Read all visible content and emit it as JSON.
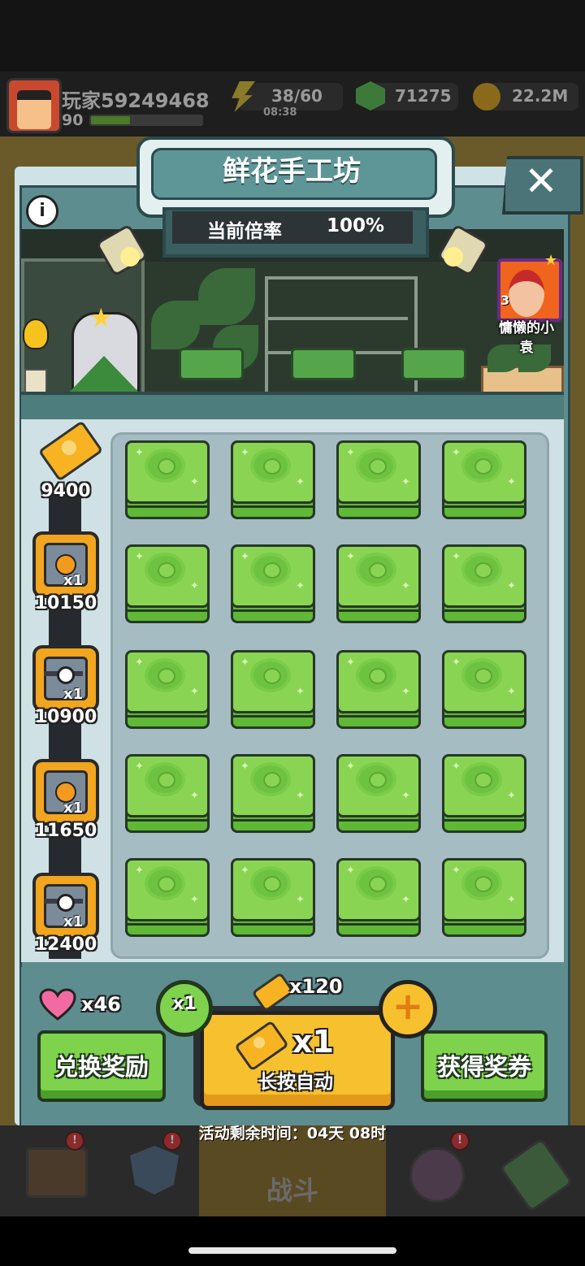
{
  "player": {
    "name": "玩家59249468",
    "level": "90",
    "level_progress": 0.35
  },
  "resources": {
    "energy": {
      "value": "38/60",
      "timer": "08:38",
      "icon": "lightning-icon"
    },
    "gems": {
      "value": "71275",
      "icon": "gem-icon"
    },
    "coins": {
      "value": "22.2M",
      "icon": "coin-icon"
    }
  },
  "modal": {
    "title": "鲜花手工坊",
    "rate_label": "当前倍率",
    "rate_value": "100%",
    "close_label": "✕",
    "info_label": "i",
    "character_name": "慵懒的小袁",
    "character_level": "3"
  },
  "track": {
    "top_ticket_value": "9400",
    "milestones": [
      {
        "value": "10150",
        "count": "x1",
        "kind": "ticket-chest"
      },
      {
        "value": "10900",
        "count": "x1",
        "kind": "ball-chest"
      },
      {
        "value": "11650",
        "count": "x1",
        "kind": "ticket-chest"
      },
      {
        "value": "12400",
        "count": "x1",
        "kind": "ball-chest"
      }
    ]
  },
  "grid": {
    "rows": 5,
    "cols": 4,
    "tile": "flower-box"
  },
  "controls": {
    "hearts": "x46",
    "exchange_label": "兑换奖励",
    "get_tickets_label": "获得奖券",
    "multiplier_badge": "x1",
    "ticket_cost": "x120",
    "main_count": "x1",
    "main_sub": "长按自动",
    "plus_label": "+"
  },
  "timer": {
    "text": "活动剩余时间：04天 08时"
  },
  "nav": {
    "center_label": "战斗",
    "alerts": [
      "!",
      "!",
      "!"
    ]
  },
  "colors": {
    "accent_green": "#7ed24c",
    "accent_yellow": "#f7c02e",
    "panel_teal": "#5e8d90"
  }
}
